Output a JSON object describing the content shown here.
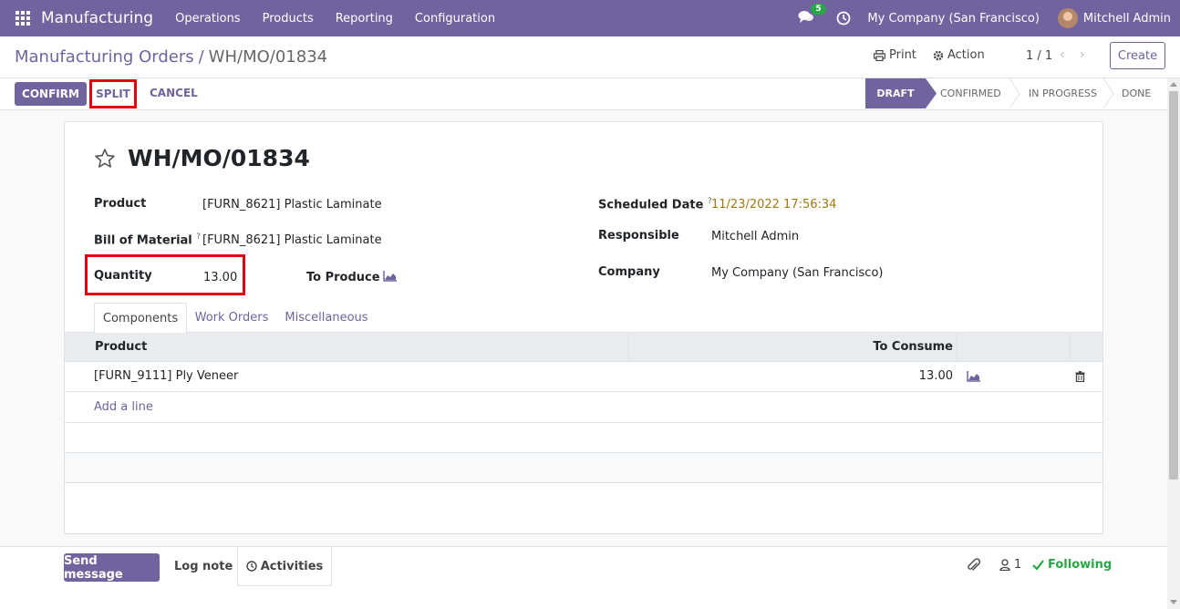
{
  "navbar": {
    "app_name": "Manufacturing",
    "menu": [
      "Operations",
      "Products",
      "Reporting",
      "Configuration"
    ],
    "chat_badge": "5",
    "company": "My Company (San Francisco)",
    "user": "Mitchell Admin"
  },
  "control_panel": {
    "breadcrumb_parent": "Manufacturing Orders",
    "breadcrumb_sep": "/",
    "breadcrumb_current": "WH/MO/01834",
    "print_label": "Print",
    "action_label": "Action",
    "pager": "1 / 1",
    "create_label": "Create"
  },
  "statusbar": {
    "confirm_label": "CONFIRM",
    "split_label": "SPLIT",
    "cancel_label": "CANCEL",
    "stages": [
      "DRAFT",
      "CONFIRMED",
      "IN PROGRESS",
      "DONE"
    ],
    "active_stage": "DRAFT"
  },
  "form": {
    "title": "WH/MO/01834",
    "product_label": "Product",
    "product_value": "[FURN_8621] Plastic Laminate",
    "bom_label": "Bill of Material",
    "bom_value": "[FURN_8621] Plastic Laminate",
    "quantity_label": "Quantity",
    "quantity_value": "13.00",
    "to_produce_label": "To Produce",
    "scheduled_date_label": "Scheduled Date",
    "scheduled_date_value": "11/23/2022 17:56:34",
    "responsible_label": "Responsible",
    "responsible_value": "Mitchell Admin",
    "company_label": "Company",
    "company_value": "My Company (San Francisco)",
    "help_mark": "?"
  },
  "tabs": [
    "Components",
    "Work Orders",
    "Miscellaneous"
  ],
  "components_table": {
    "headers": [
      "Product",
      "To Consume"
    ],
    "rows": [
      {
        "product": "[FURN_9111] Ply Veneer",
        "to_consume": "13.00"
      }
    ],
    "add_line": "Add a line"
  },
  "chatter": {
    "send_message": "Send message",
    "log_note": "Log note",
    "activities": "Activities",
    "followers_count": "1",
    "following": "Following"
  },
  "colors": {
    "brand": "#71639e",
    "highlight": "#e3000f",
    "date": "#a3780e",
    "success": "#28a745"
  }
}
